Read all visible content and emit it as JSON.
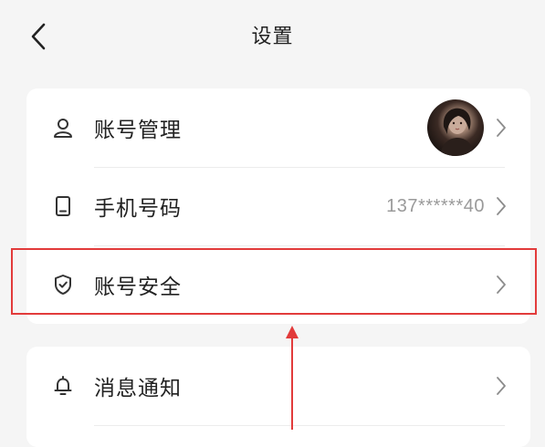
{
  "header": {
    "title": "设置",
    "back_icon": "chevron-left-icon"
  },
  "account_group": {
    "items": [
      {
        "label": "账号管理",
        "icon": "user-icon",
        "value": "",
        "has_avatar": true
      },
      {
        "label": "手机号码",
        "icon": "phone-icon",
        "value": "137******40"
      },
      {
        "label": "账号安全",
        "icon": "shield-check-icon",
        "value": ""
      }
    ]
  },
  "notification_group": {
    "items": [
      {
        "label": "消息通知",
        "icon": "bell-icon",
        "value": ""
      }
    ]
  },
  "annotation": {
    "highlight_color": "#e23b3b",
    "highlighted_item": "账号安全"
  }
}
